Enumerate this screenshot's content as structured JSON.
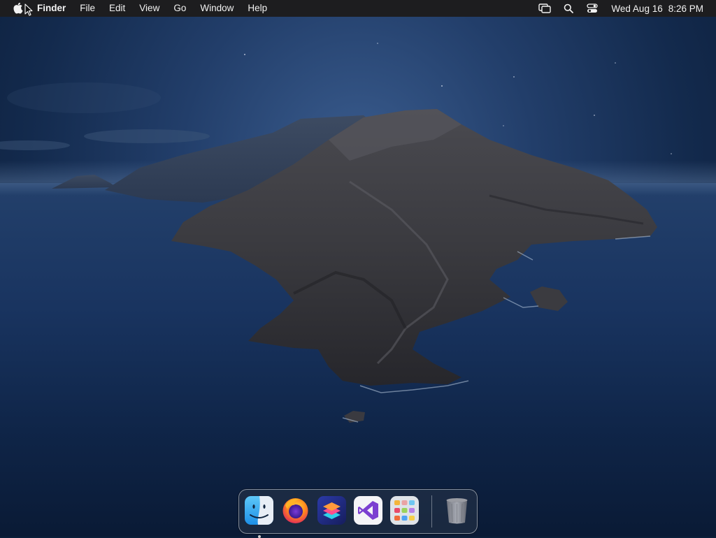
{
  "menubar": {
    "apple_icon": "apple-logo-icon",
    "app_name": "Finder",
    "menus": [
      "File",
      "Edit",
      "View",
      "Go",
      "Window",
      "Help"
    ],
    "status_icons": [
      "screen-mirroring-icon",
      "spotlight-search-icon",
      "control-center-icon"
    ],
    "clock": {
      "date": "Wed Aug 16",
      "time": "8:26 PM"
    }
  },
  "desktop": {
    "wallpaper": "catalina-island-night"
  },
  "dock": {
    "apps": [
      {
        "name": "Finder",
        "icon": "finder-icon",
        "running": true
      },
      {
        "name": "Firefox",
        "icon": "firefox-icon",
        "running": false
      },
      {
        "name": "Shortcuts",
        "icon": "shortcuts-icon",
        "running": false
      },
      {
        "name": "Visual Studio",
        "icon": "visual-studio-icon",
        "running": false
      },
      {
        "name": "Launchpad",
        "icon": "launchpad-icon",
        "running": false
      }
    ],
    "trash": {
      "name": "Trash",
      "icon": "trash-icon"
    }
  },
  "colors": {
    "menubar_bg": "#1d1d1f",
    "menubar_text": "#f2f2f2",
    "sky": "#223e6a",
    "sea": "#193460"
  }
}
